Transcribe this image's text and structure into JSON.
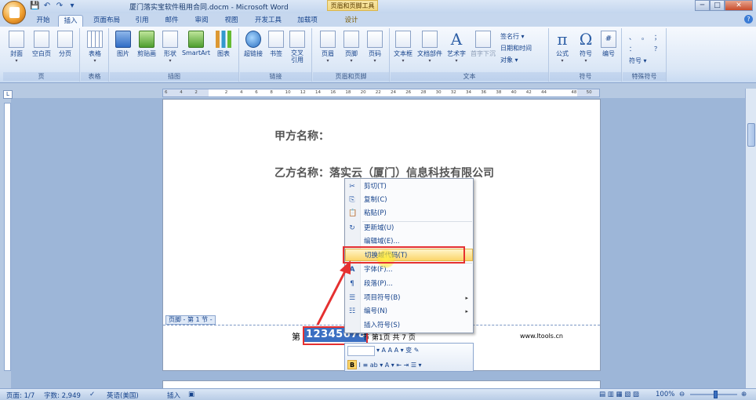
{
  "window": {
    "title": "厦门落实宝软件租用合同.docm - Microsoft Word",
    "context_tool": "页眉和页脚工具",
    "min": "─",
    "max": "□",
    "close": "✕"
  },
  "qat": [
    "💾",
    "↶",
    "↷",
    "▾"
  ],
  "tabs": [
    "开始",
    "插入",
    "页面布局",
    "引用",
    "邮件",
    "审阅",
    "视图",
    "开发工具",
    "加载项",
    "设计"
  ],
  "ribbon": {
    "groups": {
      "pages": {
        "label": "页",
        "buttons": [
          "封面",
          "空白页",
          "分页"
        ]
      },
      "tables": {
        "label": "表格",
        "buttons": [
          "表格"
        ]
      },
      "illustrations": {
        "label": "插图",
        "buttons": [
          "图片",
          "剪贴画",
          "形状",
          "SmartArt",
          "图表"
        ]
      },
      "links": {
        "label": "链接",
        "buttons": [
          "超链接",
          "书签",
          "交叉\n引用"
        ]
      },
      "header_footer": {
        "label": "页眉和页脚",
        "buttons": [
          "页眉",
          "页脚",
          "页码"
        ]
      },
      "text": {
        "label": "文本",
        "buttons": [
          "文本框",
          "文档部件",
          "艺术字",
          "首字下沉"
        ],
        "small": [
          "签名行 ▾",
          "日期和时间",
          "对象 ▾"
        ]
      },
      "symbols": {
        "label": "符号",
        "buttons": [
          "公式",
          "符号",
          "编号"
        ]
      },
      "special": {
        "label": "特殊符号",
        "items": [
          "、",
          "。",
          "；",
          "：",
          "？",
          "符号 ▾"
        ]
      }
    }
  },
  "ruler": {
    "numbers": [
      "6",
      "4",
      "2",
      "",
      "2",
      "4",
      "6",
      "8",
      "10",
      "12",
      "14",
      "16",
      "18",
      "20",
      "22",
      "24",
      "26",
      "28",
      "30",
      "32",
      "34",
      "36",
      "38",
      "40",
      "42",
      "44",
      "",
      "48",
      "50"
    ]
  },
  "document": {
    "party_a": "甲方名称：",
    "party_b": "乙方名称：落实云（厦门）信息科技有限公司",
    "footer_tag": "页脚 - 第 1 节 -",
    "footer_prefix": "第",
    "footer_selected": "12345678",
    "footer_rest": "节 第1页 共 7 页",
    "footer_url": "www.ltools.cn"
  },
  "context_menu": {
    "items": [
      {
        "label": "剪切(T)",
        "icon": "✂"
      },
      {
        "label": "复制(C)",
        "icon": "⎘"
      },
      {
        "label": "粘贴(P)",
        "icon": "📋"
      },
      {
        "label": "更新域(U)",
        "icon": "↻"
      },
      {
        "label": "编辑域(E)...",
        "icon": ""
      },
      {
        "label": "切换域代码(T)",
        "icon": ""
      },
      {
        "label": "字体(F)...",
        "icon": "A"
      },
      {
        "label": "段落(P)...",
        "icon": "¶"
      },
      {
        "label": "项目符号(B)",
        "icon": "☰"
      },
      {
        "label": "编号(N)",
        "icon": "☷"
      },
      {
        "label": "插入符号(S)",
        "icon": ""
      }
    ]
  },
  "minibar": {
    "row1": "▾  A  A  A ▾ 变 ✎",
    "row2": "I  ≡  ab ▾  A ▾  ⇤  ⇥  ☰ ▾",
    "bold": "B"
  },
  "statusbar": {
    "page": "页面: 1/7",
    "words": "字数: 2,949",
    "lang": "英语(美国)",
    "mode": "插入",
    "zoom": "100%",
    "zoom_minus": "⊖",
    "zoom_plus": "⊕"
  },
  "colors": {
    "highlight": "#fbd56a",
    "annotation_red": "#e53030",
    "selection": "#3b6fc2"
  }
}
